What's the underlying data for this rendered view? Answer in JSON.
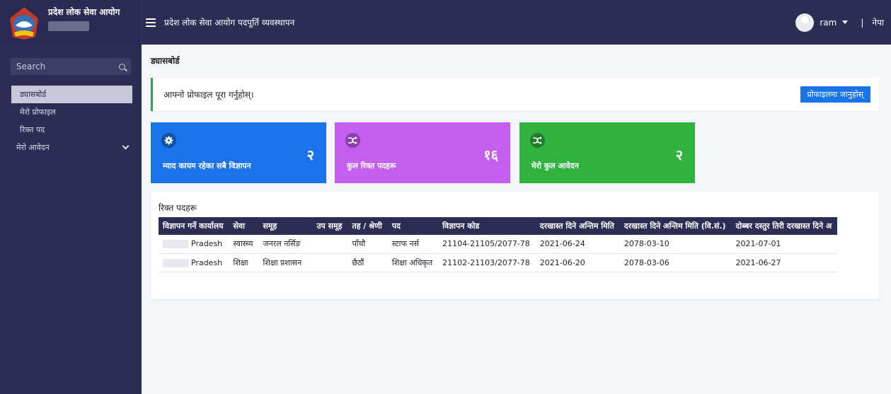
{
  "header": {
    "brand_title": "प्रदेश लोक सेवा आयोग",
    "app_title": "प्रदेश लोक सेवा आयोग पदपूर्ति व्यवस्थापन",
    "user_name": "ram",
    "separator": "|",
    "language": "नेपा"
  },
  "sidebar": {
    "search_placeholder": "Search",
    "items": [
      {
        "label": "ड्यासबोर्ड"
      },
      {
        "label": "मेरो प्रोफाइल"
      },
      {
        "label": "रिक्त पद"
      },
      {
        "label": "मेरो आवेदन"
      }
    ]
  },
  "main": {
    "page_title": "ड्यासबोर्ड",
    "alert_text": "आफ्नो प्रोफाइल पूरा गर्नुहोस्।",
    "profile_button": "प्रोफाइलमा जानुहोस्",
    "cards": [
      {
        "label": "म्याद कायम रहेका सबै विज्ञापन",
        "value": "२",
        "icon": "gear-icon",
        "color": "#1a73e8"
      },
      {
        "label": "कुल रिक्त पदहरू",
        "value": "१६",
        "icon": "shuffle-icon",
        "color": "#c35ef0"
      },
      {
        "label": "मेरो कुल आवेदन",
        "value": "२",
        "icon": "shuffle-icon",
        "color": "#30b33e"
      }
    ],
    "table": {
      "title": "रिक्त पदहरू",
      "columns": [
        "विज्ञापन गर्ने कार्यालय",
        "सेवा",
        "समूह",
        "उप समूह",
        "तह / श्रेणी",
        "पद",
        "विज्ञापन कोड",
        "दरखास्त दिने अन्तिम मिति",
        "दरखास्त दिने अन्तिम मिति (वि.सं.)",
        "दोब्बर दस्तुर तिरी दरखास्त दिने अ"
      ],
      "rows": [
        {
          "office": "Pradesh",
          "service": "स्वास्थ्य",
          "group": "जनरल नर्सिङ",
          "subgroup": "",
          "level": "पाँचौ",
          "post": "स्टाफ नर्स",
          "code": "21104-21105/2077-78",
          "deadline": "2021-06-24",
          "deadline_bs": "2078-03-10",
          "double_deadline": "2021-07-01"
        },
        {
          "office": "Pradesh",
          "service": "शिक्षा",
          "group": "शिक्षा प्रशासन",
          "subgroup": "",
          "level": "छैठौं",
          "post": "शिक्षा अधिकृत",
          "code": "21102-21103/2077-78",
          "deadline": "2021-06-20",
          "deadline_bs": "2078-03-06",
          "double_deadline": "2021-06-27"
        }
      ]
    }
  }
}
